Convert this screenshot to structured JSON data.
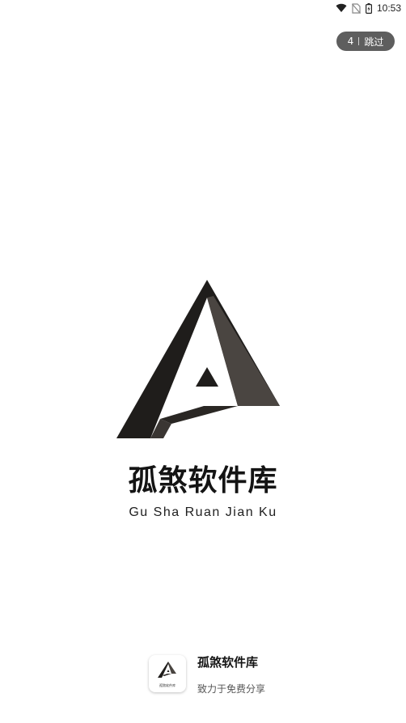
{
  "status_bar": {
    "time": "10:53",
    "icons": [
      "wifi-icon",
      "no-sim-icon",
      "battery-charging-icon"
    ]
  },
  "skip": {
    "countdown": "4",
    "label": "跳过"
  },
  "brand": {
    "title": "孤煞软件库",
    "pinyin": "Gu Sha Ruan Jian Ku"
  },
  "footer": {
    "app_name": "孤煞软件库",
    "slogan": "致力于免费分享",
    "icon_caption": "孤煞软件库"
  },
  "colors": {
    "logo_dark": "#1f1d1b",
    "logo_shade": "#4a4541",
    "skip_bg": "#5e5e5e"
  }
}
